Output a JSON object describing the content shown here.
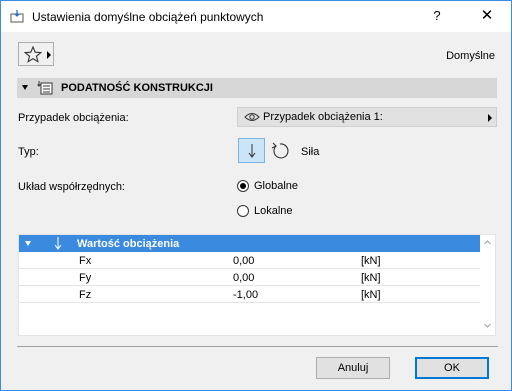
{
  "window": {
    "title": "Ustawienia domyślne obciążeń punktowych",
    "help_label": "?",
    "close_label": "✕"
  },
  "toolbar": {
    "favorites_icon": "star-icon",
    "default_label": "Domyślne"
  },
  "section": {
    "title": "PODATNOŚĆ KONSTRUKCJI",
    "icon": "structural-properties-icon"
  },
  "fields": {
    "load_case_label": "Przypadek obciążenia:",
    "load_case_value": "Przypadek obciążenia 1:",
    "type_label": "Typ:",
    "type_force_label": "Siła",
    "coords_label": "Układ współrzędnych:",
    "coords_options": [
      "Globalne",
      "Lokalne"
    ],
    "coords_selected": "Globalne"
  },
  "load_table": {
    "header": "Wartość obciążenia",
    "rows": [
      {
        "name": "Fx",
        "value": "0,00",
        "unit": "[kN]"
      },
      {
        "name": "Fy",
        "value": "0,00",
        "unit": "[kN]"
      },
      {
        "name": "Fz",
        "value": "-1,00",
        "unit": "[kN]"
      }
    ]
  },
  "footer": {
    "cancel_label": "Anuluj",
    "ok_label": "OK"
  },
  "colors": {
    "accent": "#3a8be0",
    "section_bg": "#d7d7d7",
    "selected_btn": "#cce4f7"
  }
}
